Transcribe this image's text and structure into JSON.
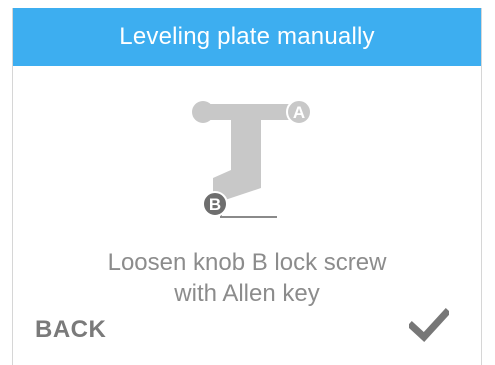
{
  "header": {
    "title": "Leveling plate manually",
    "background_color": "#3daef0"
  },
  "diagram": {
    "knob_a_label": "A",
    "knob_b_label": "B",
    "arm_color": "#c8c8c8",
    "knob_b_color": "#6e6e6e"
  },
  "instruction": {
    "line1": "Loosen knob B lock screw",
    "line2": "with Allen key"
  },
  "footer": {
    "back_label": "BACK",
    "confirm_icon": "checkmark-icon"
  }
}
